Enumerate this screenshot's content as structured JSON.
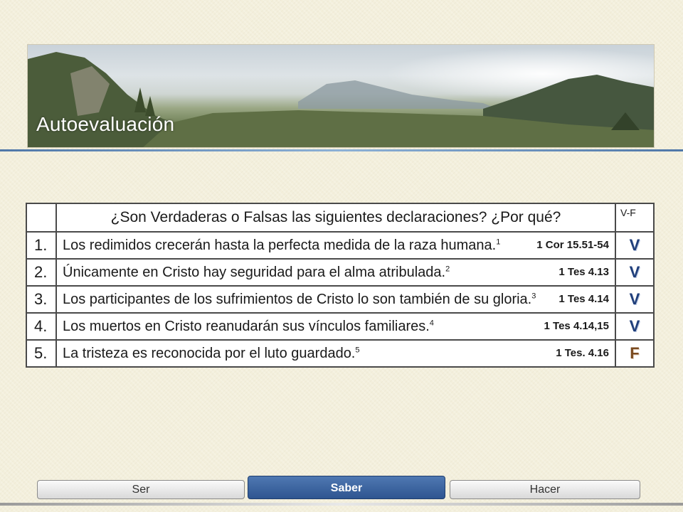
{
  "header": {
    "title": "Autoevaluación"
  },
  "quiz": {
    "question": "¿Son Verdaderas o Falsas las siguientes declaraciones? ¿Por qué?",
    "vf_label": "V-F",
    "rows": [
      {
        "num": "1.",
        "text": "Los redimidos crecerán hasta la perfecta medida de la raza humana.",
        "note": "1",
        "ref": "1 Cor 15.51-54",
        "answer": "V"
      },
      {
        "num": "2.",
        "text": "Únicamente en Cristo hay seguridad para el alma atribulada.",
        "note": "2",
        "ref": "1 Tes 4.13",
        "answer": "V"
      },
      {
        "num": "3.",
        "text": "Los participantes de los sufrimientos de Cristo lo son también de su gloria.",
        "note": "3",
        "ref": "1 Tes 4.14",
        "answer": "V"
      },
      {
        "num": "4.",
        "text": "Los muertos en Cristo reanudarán sus vínculos familiares.",
        "note": "4",
        "ref": "1 Tes 4.14,15",
        "answer": "V"
      },
      {
        "num": "5.",
        "text": "La tristeza es reconocida por el luto guardado.",
        "note": "5",
        "ref": "1 Tes. 4.16",
        "answer": "F"
      }
    ]
  },
  "nav": {
    "ser": "Ser",
    "saber": "Saber",
    "hacer": "Hacer"
  },
  "colors": {
    "accent": "#2e5590",
    "answer_true": "#1f3e7a",
    "answer_false": "#7a4a1f"
  }
}
